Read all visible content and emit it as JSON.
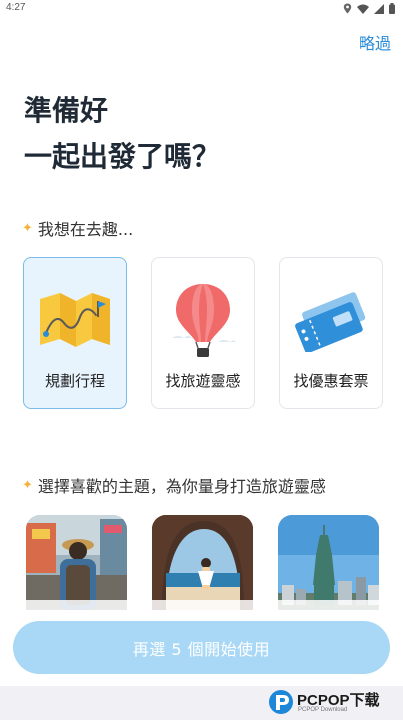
{
  "status_bar": {
    "time": "4:27"
  },
  "header": {
    "skip_label": "略過"
  },
  "title": {
    "line1": "準備好",
    "line2": "一起出發了嗎？"
  },
  "section1": {
    "star": "✦",
    "label": "我想在去趣..."
  },
  "goals": [
    {
      "label": "規劃行程",
      "icon": "folded-map-icon",
      "selected": true
    },
    {
      "label": "找旅遊靈感",
      "icon": "hot-air-balloon-icon",
      "selected": false
    },
    {
      "label": "找優惠套票",
      "icon": "ticket-icon",
      "selected": false
    }
  ],
  "section2": {
    "star": "✦",
    "label": "選擇喜歡的主題，為你量身打造旅遊靈感"
  },
  "themes": [
    {
      "name": "backpacker-street-photo"
    },
    {
      "name": "rock-arch-beach-photo"
    },
    {
      "name": "taipei-101-skyline-photo"
    }
  ],
  "cta": {
    "label": "再選 5 個開始使用"
  },
  "watermark": {
    "text": "PCPOP下载",
    "subtext": "PCPOP Download"
  },
  "colors": {
    "accent": "#2a8bd8",
    "cta_bg": "#a8d8f5",
    "selected_card_bg": "#e8f4fd",
    "star": "#f2b43c"
  }
}
